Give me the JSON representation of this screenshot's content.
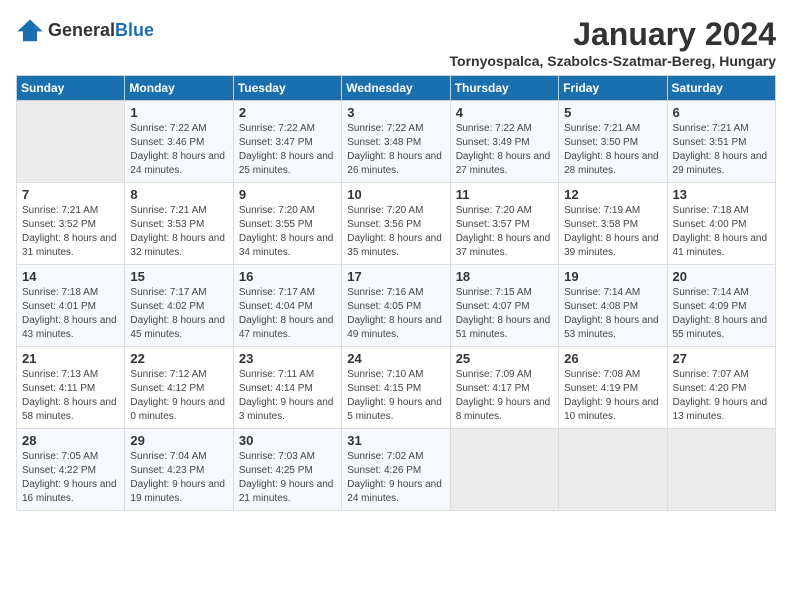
{
  "header": {
    "logo_general": "General",
    "logo_blue": "Blue",
    "month_title": "January 2024",
    "location": "Tornyospalca, Szabolcs-Szatmar-Bereg, Hungary"
  },
  "weekdays": [
    "Sunday",
    "Monday",
    "Tuesday",
    "Wednesday",
    "Thursday",
    "Friday",
    "Saturday"
  ],
  "weeks": [
    [
      {
        "day": "",
        "sunrise": "",
        "sunset": "",
        "daylight": ""
      },
      {
        "day": "1",
        "sunrise": "Sunrise: 7:22 AM",
        "sunset": "Sunset: 3:46 PM",
        "daylight": "Daylight: 8 hours and 24 minutes."
      },
      {
        "day": "2",
        "sunrise": "Sunrise: 7:22 AM",
        "sunset": "Sunset: 3:47 PM",
        "daylight": "Daylight: 8 hours and 25 minutes."
      },
      {
        "day": "3",
        "sunrise": "Sunrise: 7:22 AM",
        "sunset": "Sunset: 3:48 PM",
        "daylight": "Daylight: 8 hours and 26 minutes."
      },
      {
        "day": "4",
        "sunrise": "Sunrise: 7:22 AM",
        "sunset": "Sunset: 3:49 PM",
        "daylight": "Daylight: 8 hours and 27 minutes."
      },
      {
        "day": "5",
        "sunrise": "Sunrise: 7:21 AM",
        "sunset": "Sunset: 3:50 PM",
        "daylight": "Daylight: 8 hours and 28 minutes."
      },
      {
        "day": "6",
        "sunrise": "Sunrise: 7:21 AM",
        "sunset": "Sunset: 3:51 PM",
        "daylight": "Daylight: 8 hours and 29 minutes."
      }
    ],
    [
      {
        "day": "7",
        "sunrise": "Sunrise: 7:21 AM",
        "sunset": "Sunset: 3:52 PM",
        "daylight": "Daylight: 8 hours and 31 minutes."
      },
      {
        "day": "8",
        "sunrise": "Sunrise: 7:21 AM",
        "sunset": "Sunset: 3:53 PM",
        "daylight": "Daylight: 8 hours and 32 minutes."
      },
      {
        "day": "9",
        "sunrise": "Sunrise: 7:20 AM",
        "sunset": "Sunset: 3:55 PM",
        "daylight": "Daylight: 8 hours and 34 minutes."
      },
      {
        "day": "10",
        "sunrise": "Sunrise: 7:20 AM",
        "sunset": "Sunset: 3:56 PM",
        "daylight": "Daylight: 8 hours and 35 minutes."
      },
      {
        "day": "11",
        "sunrise": "Sunrise: 7:20 AM",
        "sunset": "Sunset: 3:57 PM",
        "daylight": "Daylight: 8 hours and 37 minutes."
      },
      {
        "day": "12",
        "sunrise": "Sunrise: 7:19 AM",
        "sunset": "Sunset: 3:58 PM",
        "daylight": "Daylight: 8 hours and 39 minutes."
      },
      {
        "day": "13",
        "sunrise": "Sunrise: 7:18 AM",
        "sunset": "Sunset: 4:00 PM",
        "daylight": "Daylight: 8 hours and 41 minutes."
      }
    ],
    [
      {
        "day": "14",
        "sunrise": "Sunrise: 7:18 AM",
        "sunset": "Sunset: 4:01 PM",
        "daylight": "Daylight: 8 hours and 43 minutes."
      },
      {
        "day": "15",
        "sunrise": "Sunrise: 7:17 AM",
        "sunset": "Sunset: 4:02 PM",
        "daylight": "Daylight: 8 hours and 45 minutes."
      },
      {
        "day": "16",
        "sunrise": "Sunrise: 7:17 AM",
        "sunset": "Sunset: 4:04 PM",
        "daylight": "Daylight: 8 hours and 47 minutes."
      },
      {
        "day": "17",
        "sunrise": "Sunrise: 7:16 AM",
        "sunset": "Sunset: 4:05 PM",
        "daylight": "Daylight: 8 hours and 49 minutes."
      },
      {
        "day": "18",
        "sunrise": "Sunrise: 7:15 AM",
        "sunset": "Sunset: 4:07 PM",
        "daylight": "Daylight: 8 hours and 51 minutes."
      },
      {
        "day": "19",
        "sunrise": "Sunrise: 7:14 AM",
        "sunset": "Sunset: 4:08 PM",
        "daylight": "Daylight: 8 hours and 53 minutes."
      },
      {
        "day": "20",
        "sunrise": "Sunrise: 7:14 AM",
        "sunset": "Sunset: 4:09 PM",
        "daylight": "Daylight: 8 hours and 55 minutes."
      }
    ],
    [
      {
        "day": "21",
        "sunrise": "Sunrise: 7:13 AM",
        "sunset": "Sunset: 4:11 PM",
        "daylight": "Daylight: 8 hours and 58 minutes."
      },
      {
        "day": "22",
        "sunrise": "Sunrise: 7:12 AM",
        "sunset": "Sunset: 4:12 PM",
        "daylight": "Daylight: 9 hours and 0 minutes."
      },
      {
        "day": "23",
        "sunrise": "Sunrise: 7:11 AM",
        "sunset": "Sunset: 4:14 PM",
        "daylight": "Daylight: 9 hours and 3 minutes."
      },
      {
        "day": "24",
        "sunrise": "Sunrise: 7:10 AM",
        "sunset": "Sunset: 4:15 PM",
        "daylight": "Daylight: 9 hours and 5 minutes."
      },
      {
        "day": "25",
        "sunrise": "Sunrise: 7:09 AM",
        "sunset": "Sunset: 4:17 PM",
        "daylight": "Daylight: 9 hours and 8 minutes."
      },
      {
        "day": "26",
        "sunrise": "Sunrise: 7:08 AM",
        "sunset": "Sunset: 4:19 PM",
        "daylight": "Daylight: 9 hours and 10 minutes."
      },
      {
        "day": "27",
        "sunrise": "Sunrise: 7:07 AM",
        "sunset": "Sunset: 4:20 PM",
        "daylight": "Daylight: 9 hours and 13 minutes."
      }
    ],
    [
      {
        "day": "28",
        "sunrise": "Sunrise: 7:05 AM",
        "sunset": "Sunset: 4:22 PM",
        "daylight": "Daylight: 9 hours and 16 minutes."
      },
      {
        "day": "29",
        "sunrise": "Sunrise: 7:04 AM",
        "sunset": "Sunset: 4:23 PM",
        "daylight": "Daylight: 9 hours and 19 minutes."
      },
      {
        "day": "30",
        "sunrise": "Sunrise: 7:03 AM",
        "sunset": "Sunset: 4:25 PM",
        "daylight": "Daylight: 9 hours and 21 minutes."
      },
      {
        "day": "31",
        "sunrise": "Sunrise: 7:02 AM",
        "sunset": "Sunset: 4:26 PM",
        "daylight": "Daylight: 9 hours and 24 minutes."
      },
      {
        "day": "",
        "sunrise": "",
        "sunset": "",
        "daylight": ""
      },
      {
        "day": "",
        "sunrise": "",
        "sunset": "",
        "daylight": ""
      },
      {
        "day": "",
        "sunrise": "",
        "sunset": "",
        "daylight": ""
      }
    ]
  ]
}
